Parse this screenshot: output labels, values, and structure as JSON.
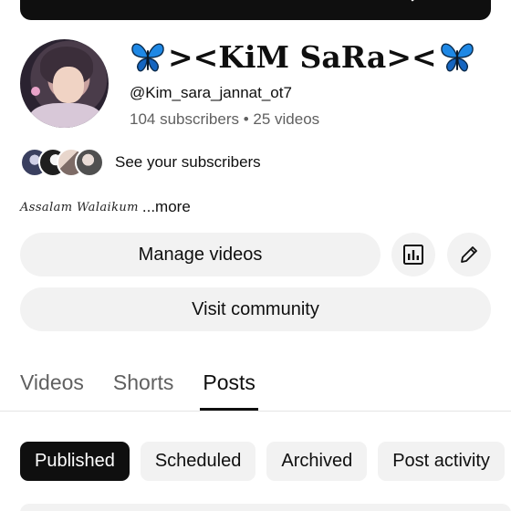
{
  "channel": {
    "name_prefix_icon": "blue-butterfly",
    "name": "><KiM SaRa><",
    "name_suffix_icon": "blue-butterfly",
    "handle": "@Kim_sara_jannat_ot7",
    "stats": "104 subscribers • 25 videos"
  },
  "subscribers_row": {
    "label": "See your subscribers"
  },
  "description": {
    "text": "Assalam Walaikum",
    "more_label": "...more"
  },
  "actions": {
    "manage_label": "Manage videos",
    "analytics_icon": "analytics-icon",
    "edit_icon": "pencil-icon",
    "visit_label": "Visit community"
  },
  "tabs": [
    {
      "label": "Videos",
      "active": false
    },
    {
      "label": "Shorts",
      "active": false
    },
    {
      "label": "Posts",
      "active": true
    }
  ],
  "filter_chips": [
    {
      "label": "Published",
      "selected": true
    },
    {
      "label": "Scheduled",
      "selected": false
    },
    {
      "label": "Archived",
      "selected": false
    },
    {
      "label": "Post activity",
      "selected": false
    }
  ],
  "colors": {
    "text_primary": "#0f0f0f",
    "text_secondary": "#606060",
    "button_bg": "#f2f2f2",
    "butterfly_blue": "#1e88e5"
  }
}
